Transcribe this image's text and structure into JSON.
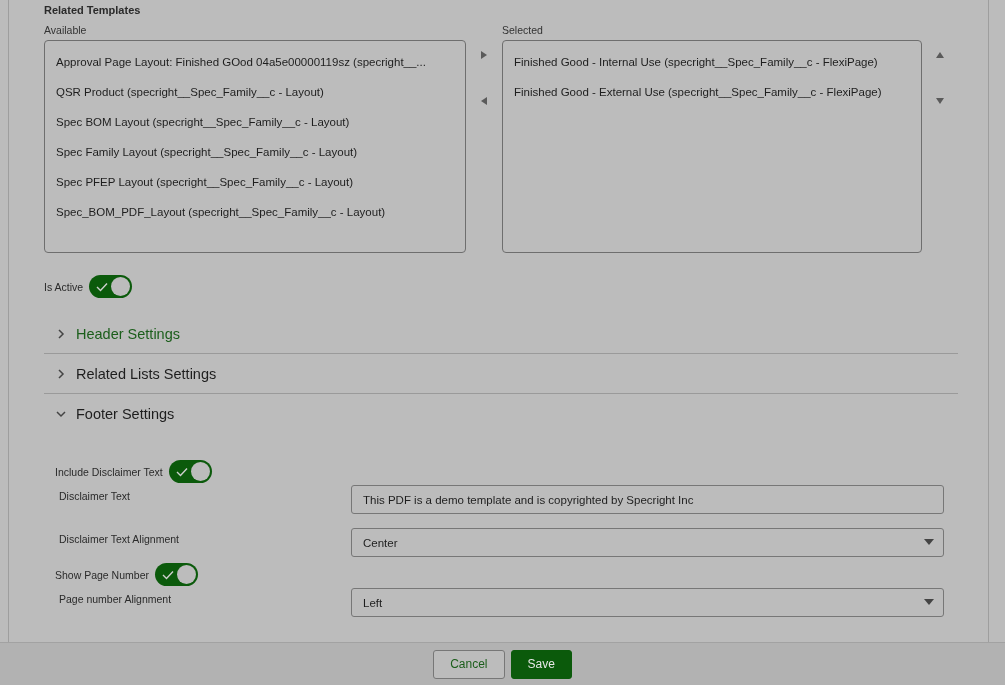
{
  "related_templates": {
    "title": "Related Templates",
    "available": {
      "label": "Available",
      "items": [
        "Approval Page Layout: Finished GOod 04a5e00000119sz (specright__...",
        "QSR Product (specright__Spec_Family__c - Layout)",
        "Spec BOM Layout (specright__Spec_Family__c - Layout)",
        "Spec Family Layout (specright__Spec_Family__c - Layout)",
        "Spec PFEP Layout (specright__Spec_Family__c - Layout)",
        "Spec_BOM_PDF_Layout (specright__Spec_Family__c - Layout)"
      ]
    },
    "selected": {
      "label": "Selected",
      "items": [
        "Finished Good - Internal Use (specright__Spec_Family__c - FlexiPage)",
        "Finished Good - External Use (specright__Spec_Family__c - FlexiPage)"
      ]
    }
  },
  "is_active": {
    "label": "Is Active",
    "on": true
  },
  "sections": [
    {
      "title": "Header Settings",
      "expanded": false,
      "active": true
    },
    {
      "title": "Related Lists Settings",
      "expanded": false,
      "active": false
    },
    {
      "title": "Footer Settings",
      "expanded": true,
      "active": false
    }
  ],
  "footer_fields": [
    {
      "kind": "toggle",
      "label": "Include Disclaimer Text",
      "on": true
    },
    {
      "kind": "text",
      "label": "Disclaimer Text",
      "value": "This PDF is a demo template and is copyrighted by Specright Inc"
    },
    {
      "kind": "select",
      "label": "Disclaimer Text Alignment",
      "value": "Center"
    },
    {
      "kind": "toggle",
      "label": "Show Page Number",
      "on": true
    },
    {
      "kind": "select",
      "label": "Page number Alignment",
      "value": "Left"
    }
  ],
  "buttons": [
    {
      "label": "Cancel",
      "kind": "neutral"
    },
    {
      "label": "Save",
      "kind": "brand"
    }
  ]
}
